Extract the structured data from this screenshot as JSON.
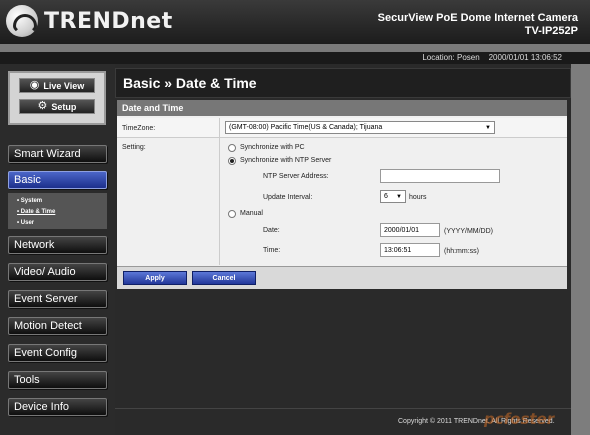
{
  "brand": {
    "logo_text": "TRENDnet"
  },
  "product": {
    "name": "SecurView PoE Dome Internet Camera",
    "model": "TV-IP252P"
  },
  "status_bar": {
    "location_label": "Location:",
    "location_value": "Posen",
    "datetime": "2000/01/01 13:06:52"
  },
  "view_buttons": {
    "live_view": "Live View",
    "setup": "Setup"
  },
  "sidebar": {
    "items": [
      {
        "label": "Smart Wizard"
      },
      {
        "label": "Basic"
      },
      {
        "label": "Network"
      },
      {
        "label": "Video/ Audio"
      },
      {
        "label": "Event Server"
      },
      {
        "label": "Motion Detect"
      },
      {
        "label": "Event Config"
      },
      {
        "label": "Tools"
      },
      {
        "label": "Device Info"
      }
    ],
    "submenu": [
      "• System",
      "• Date & Time",
      "• User"
    ]
  },
  "page": {
    "title": "Basic » Date & Time",
    "section": "Date and Time"
  },
  "form": {
    "timezone_label": "TimeZone:",
    "timezone_value": "(GMT-08:00) Pacific Time(US & Canada); Tijuana",
    "setting_label": "Setting:",
    "sync_pc": "Synchronize with PC",
    "sync_ntp": "Synchronize with NTP Server",
    "ntp_label": "NTP Server Address:",
    "ntp_value": "",
    "interval_label": "Update Interval:",
    "interval_value": "6",
    "interval_unit": "hours",
    "manual": "Manual",
    "date_label": "Date:",
    "date_value": "2000/01/01",
    "date_format": "(YYYY/MM/DD)",
    "time_label": "Time:",
    "time_value": "13:06:51",
    "time_format": "(hh:mm:ss)",
    "selected_mode": "sync_ntp"
  },
  "actions": {
    "apply": "Apply",
    "cancel": "Cancel"
  },
  "footer": {
    "copyright": "Copyright © 2011 TRENDnet. All Rights Reserved."
  },
  "watermark": "pcfoster",
  "colors": {
    "active_menu": "#2a41a8",
    "button_blue": "#3350c0",
    "panel_header": "#777777"
  }
}
